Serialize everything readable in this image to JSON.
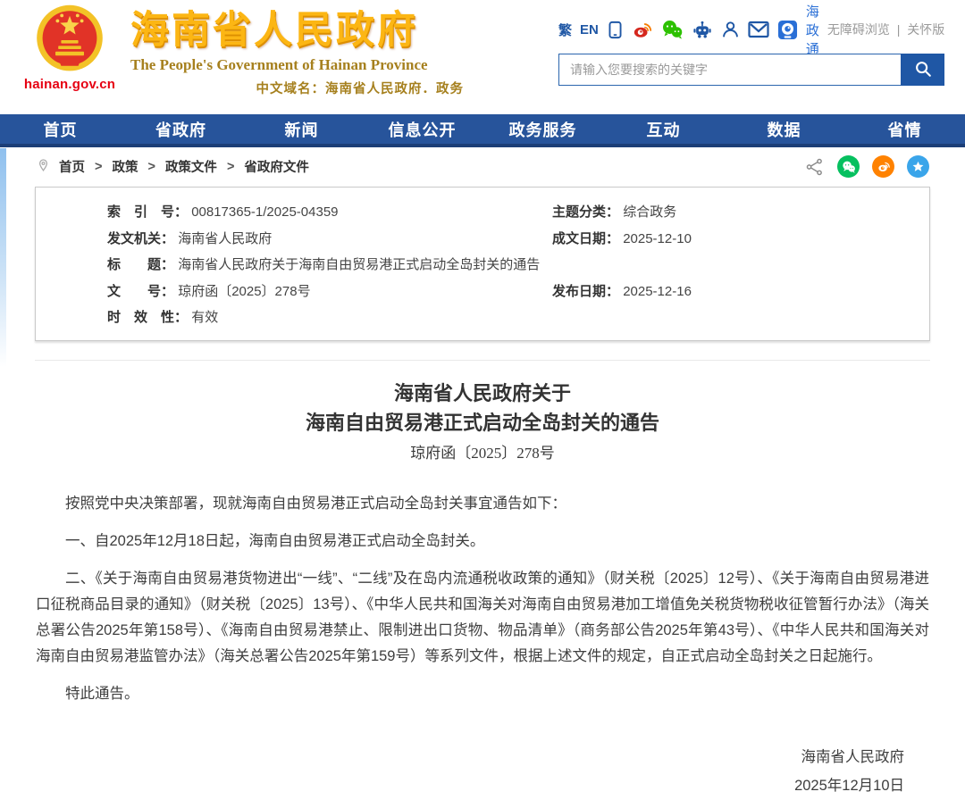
{
  "colors": {
    "nav_blue": "#27549b",
    "accent_blue": "#1f57a5",
    "title_gold": "#fcb614",
    "subtitle_gold": "#a6801e",
    "logo_red": "#e60012",
    "wechat_green": "#06c05f",
    "weibo_orange": "#ff8200",
    "qzone_blue": "#3aa5ea"
  },
  "header": {
    "logo_domain": "hainan.gov.cn",
    "site_title": "海南省人民政府",
    "site_subtitle_en": "The People's Government  of Hainan Province",
    "site_domain_line": "中文域名：海南省人民政府．政务",
    "quick_links": {
      "traditional": "繁",
      "english": "EN",
      "haizhengtong": "海政通",
      "accessibility": "无障碍浏览",
      "separator": "|",
      "care_edition": "关怀版"
    },
    "search": {
      "placeholder": "请输入您要搜索的关键字"
    }
  },
  "nav": {
    "items": [
      {
        "label": "首页"
      },
      {
        "label": "省政府"
      },
      {
        "label": "新闻"
      },
      {
        "label": "信息公开"
      },
      {
        "label": "政务服务"
      },
      {
        "label": "互动"
      },
      {
        "label": "数据"
      },
      {
        "label": "省情"
      }
    ]
  },
  "breadcrumb": {
    "separator": ">",
    "items": [
      "首页",
      "政策",
      "政策文件",
      "省政府文件"
    ]
  },
  "meta_table": {
    "rows": [
      {
        "ll": "索　引　号：",
        "lv": "00817365-1/2025-04359",
        "rl": "主题分类：",
        "rv": "综合政务"
      },
      {
        "ll": "发文机关：",
        "lv": "海南省人民政府",
        "rl": "成文日期：",
        "rv": "2025-12-10"
      },
      {
        "ll": "标　　题：",
        "lv": "海南省人民政府关于海南自由贸易港正式启动全岛封关的通告",
        "rl": "",
        "rv": ""
      },
      {
        "ll": "文　　号：",
        "lv": "琼府函〔2025〕278号",
        "rl": "发布日期：",
        "rv": "2025-12-16"
      },
      {
        "ll": "时　效　性：",
        "lv": "有效",
        "rl": "",
        "rv": ""
      }
    ]
  },
  "document": {
    "title_line1": "海南省人民政府关于",
    "title_line2": "海南自由贸易港正式启动全岛封关的通告",
    "doc_number": "琼府函〔2025〕278号",
    "paragraphs": [
      "按照党中央决策部署，现就海南自由贸易港正式启动全岛封关事宜通告如下：",
      "一、自2025年12月18日起，海南自由贸易港正式启动全岛封关。",
      "二、《关于海南自由贸易港货物进出“一线”、“二线”及在岛内流通税收政策的通知》（财关税〔2025〕12号）、《关于海南自由贸易港进口征税商品目录的通知》（财关税〔2025〕13号）、《中华人民共和国海关对海南自由贸易港加工增值免关税货物税收征管暂行办法》（海关总署公告2025年第158号）、《海南自由贸易港禁止、限制进出口货物、物品清单》（商务部公告2025年第43号）、《中华人民共和国海关对海南自由贸易港监管办法》（海关总署公告2025年第159号）等系列文件，根据上述文件的规定，自正式启动全岛封关之日起施行。",
      "特此通告。"
    ],
    "signature": {
      "name": "海南省人民政府",
      "date": "2025年12月10日"
    }
  }
}
